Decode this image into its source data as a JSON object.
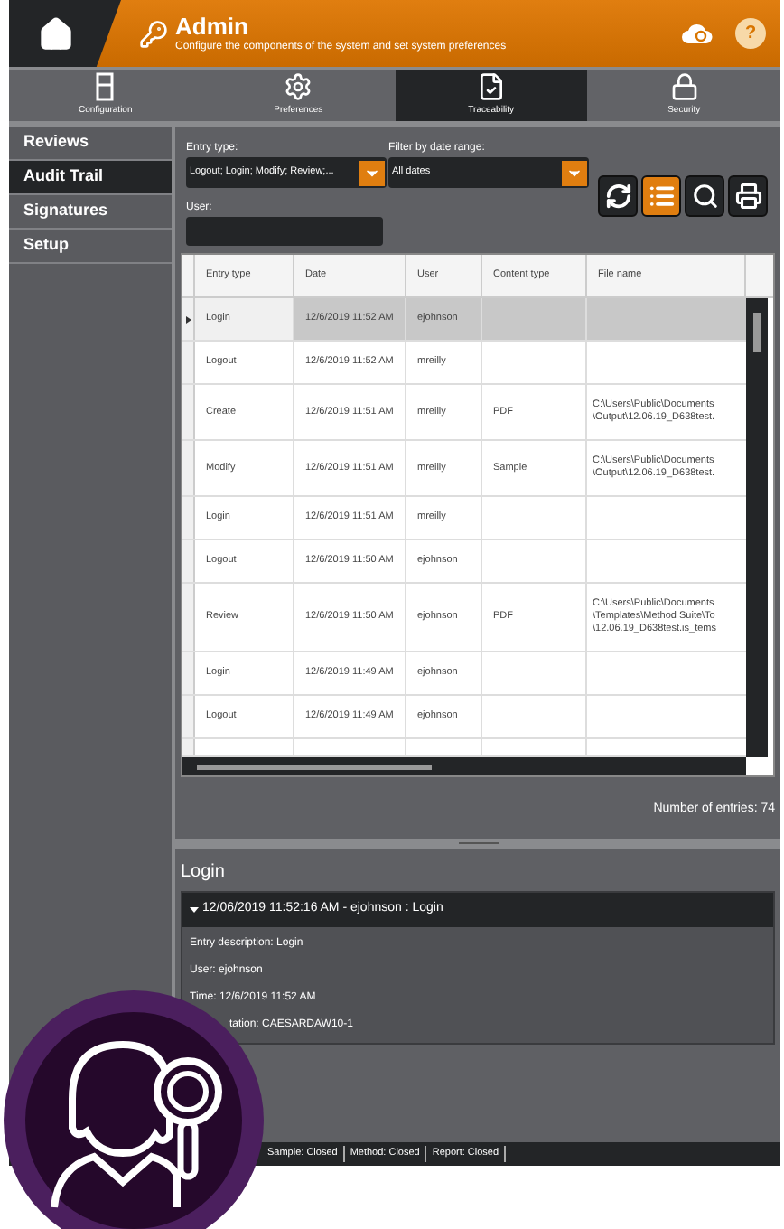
{
  "header": {
    "title": "Admin",
    "subtitle": "Configure the components of the system and set system preferences",
    "help": "?"
  },
  "tabs": [
    {
      "label": "Configuration",
      "kind": "panel",
      "selected": false
    },
    {
      "label": "Preferences",
      "kind": "gear",
      "selected": false
    },
    {
      "label": "Traceability",
      "kind": "document",
      "selected": true
    },
    {
      "label": "Security",
      "kind": "lock",
      "selected": false
    }
  ],
  "sidebar": {
    "items": [
      {
        "label": "Reviews",
        "selected": false
      },
      {
        "label": "Audit Trail",
        "selected": true
      },
      {
        "label": "Signatures",
        "selected": false
      },
      {
        "label": "Setup",
        "selected": false
      }
    ]
  },
  "filters": {
    "entry_type": {
      "label": "Entry type:",
      "value": "Logout; Login; Modify; Review;..."
    },
    "date_range": {
      "label": "Filter by date range:",
      "value": "All dates"
    },
    "user": {
      "label": "User:"
    }
  },
  "toolbar": [
    {
      "kind": "refresh",
      "selected": false
    },
    {
      "kind": "list",
      "selected": true
    },
    {
      "kind": "search",
      "selected": false
    },
    {
      "kind": "print",
      "selected": false
    }
  ],
  "table": {
    "columns": [
      "Entry type",
      "Date",
      "User",
      "Content type",
      "File name"
    ],
    "rows": [
      {
        "selected": true,
        "cells": [
          "Login",
          "12/6/2019 11:52 AM",
          "ejohnson",
          ""
        ],
        "file_name": []
      },
      {
        "selected": false,
        "cells": [
          "Logout",
          "12/6/2019 11:52 AM",
          "mreilly",
          ""
        ],
        "file_name": []
      },
      {
        "selected": false,
        "cells": [
          "Create",
          "12/6/2019 11:51 AM",
          "mreilly",
          "PDF"
        ],
        "file_name": [
          "C:\\Users\\Public\\Documents",
          "\\Output\\12.06.19_D638test."
        ]
      },
      {
        "selected": false,
        "cells": [
          "Modify",
          "12/6/2019 11:51 AM",
          "mreilly",
          "Sample"
        ],
        "file_name": [
          "C:\\Users\\Public\\Documents",
          "\\Output\\12.06.19_D638test."
        ]
      },
      {
        "selected": false,
        "cells": [
          "Login",
          "12/6/2019 11:51 AM",
          "mreilly",
          ""
        ],
        "file_name": []
      },
      {
        "selected": false,
        "cells": [
          "Logout",
          "12/6/2019 11:50 AM",
          "ejohnson",
          ""
        ],
        "file_name": []
      },
      {
        "selected": false,
        "cells": [
          "Review",
          "12/6/2019 11:50 AM",
          "ejohnson",
          "PDF"
        ],
        "file_name": [
          "C:\\Users\\Public\\Documents",
          "\\Templates\\Method Suite\\To",
          "\\12.06.19_D638test.is_tems"
        ]
      },
      {
        "selected": false,
        "cells": [
          "Login",
          "12/6/2019 11:49 AM",
          "ejohnson",
          ""
        ],
        "file_name": []
      },
      {
        "selected": false,
        "cells": [
          "Logout",
          "12/6/2019 11:49 AM",
          "ejohnson",
          ""
        ],
        "file_name": []
      }
    ]
  },
  "entries_count": "Number of entries: 74",
  "detail": {
    "title": "Login",
    "header": "12/06/2019 11:52:16 AM - ejohnson : Login",
    "expanded": true,
    "lines": [
      "Entry description: Login",
      "User: ejohnson",
      "Time: 12/6/2019 11:52 AM",
      "tation: CAESARDAW10-1"
    ]
  },
  "status_bar": {
    "items": [
      "Sample: Closed",
      "Method: Closed",
      "Report: Closed"
    ]
  }
}
